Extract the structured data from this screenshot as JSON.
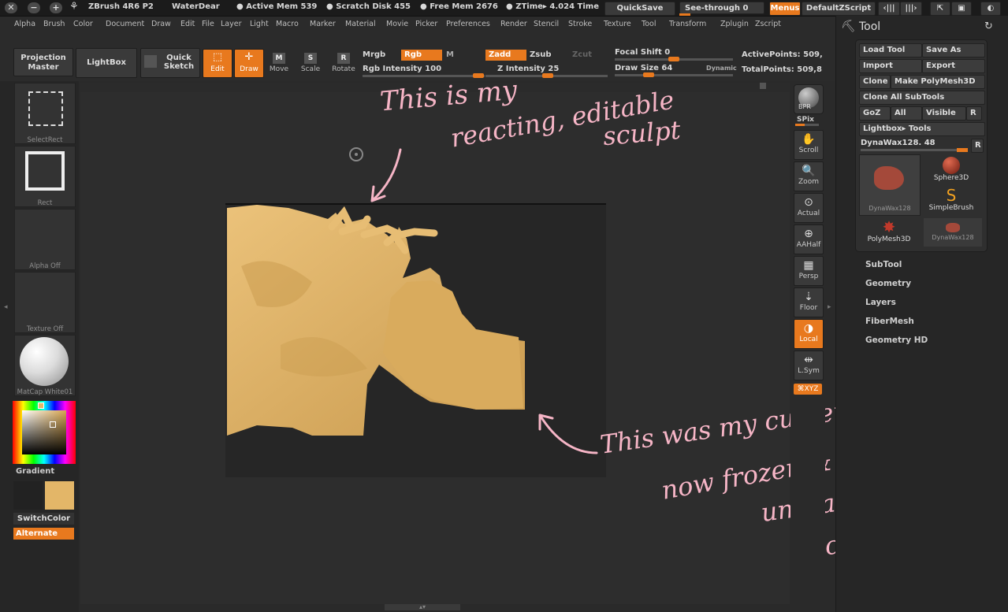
{
  "titlebar": {
    "app": "ZBrush 4R6 P2",
    "user": "WaterDear",
    "active_mem": "● Active Mem 539",
    "scratch": "● Scratch Disk 455",
    "free_mem": "● Free Mem 2676",
    "ztime": "● ZTime▸ 4.024 Time",
    "quicksave": "QuickSave",
    "seethrough": "See-through   0",
    "menus": "Menus",
    "script": "DefaultZScript"
  },
  "menu": [
    "Alpha",
    "Brush",
    "Color",
    "Document",
    "Draw",
    "Edit",
    "File",
    "Layer",
    "Light",
    "Macro",
    "Marker",
    "Material",
    "Movie",
    "Picker",
    "Preferences",
    "Render",
    "Stencil",
    "Stroke",
    "Texture",
    "Tool",
    "Transform",
    "Zplugin",
    "Zscript"
  ],
  "toolbar": {
    "projection_master": "Projection Master",
    "lightbox": "LightBox",
    "quick_sketch": "Quick Sketch",
    "edit": "Edit",
    "draw": "Draw",
    "move": "Move",
    "scale": "Scale",
    "rotate": "Rotate",
    "mrgb": "Mrgb",
    "rgb": "Rgb",
    "m": "M",
    "rgb_intensity": "Rgb Intensity 100",
    "zadd": "Zadd",
    "zsub": "Zsub",
    "zcut": "Zcut",
    "z_intensity": "Z Intensity 25",
    "focal_shift": "Focal Shift 0",
    "draw_size": "Draw Size 64",
    "dynamic": "Dynamic",
    "active_points": "ActivePoints: 509,",
    "total_points": "TotalPoints: 509,8"
  },
  "left": {
    "selectrect": "SelectRect",
    "rect": "Rect",
    "alpha": "Alpha  Off",
    "texture": "Texture  Off",
    "matcap": "MatCap  White01",
    "gradient": "Gradient",
    "switchcolor": "SwitchColor",
    "alternate": "Alternate"
  },
  "right": {
    "bpr": "BPR",
    "spix": "SPix",
    "scroll": "Scroll",
    "zoom": "Zoom",
    "actual": "Actual",
    "aahalf": "AAHalf",
    "persp": "Persp",
    "floor": "Floor",
    "local": "Local",
    "lsym": "L.Sym",
    "xyz": "⌘XYZ"
  },
  "tool": {
    "title": "Tool",
    "load": "Load Tool",
    "saveas": "Save As",
    "import": "Import",
    "export": "Export",
    "clone": "Clone",
    "make_polymesh": "Make PolyMesh3D",
    "clone_all": "Clone  All  SubTools",
    "goz": "GoZ",
    "all": "All",
    "visible": "Visible",
    "r": "R",
    "lightbox_tools": "Lightbox▸ Tools",
    "current_tool": "DynaWax128. 48",
    "thumbs": [
      "DynaWax128",
      "Sphere3D",
      "SimpleBrush",
      "PolyMesh3D",
      "DynaWax128"
    ],
    "sections": [
      "SubTool",
      "Geometry",
      "Layers",
      "FiberMesh",
      "Geometry HD"
    ]
  },
  "annotations": {
    "top_line1": "This is my",
    "top_line2": "reacting, editable",
    "top_line3": "sculpt",
    "bottom_line1": "This was my current,",
    "bottom_line2": "now frozen &",
    "bottom_line3": "unreacting",
    "bottom_line4": "sculpt"
  },
  "colors": {
    "accent": "#e8791e",
    "sculpt": "#e3b668",
    "annotation": "#f6b5c6"
  }
}
